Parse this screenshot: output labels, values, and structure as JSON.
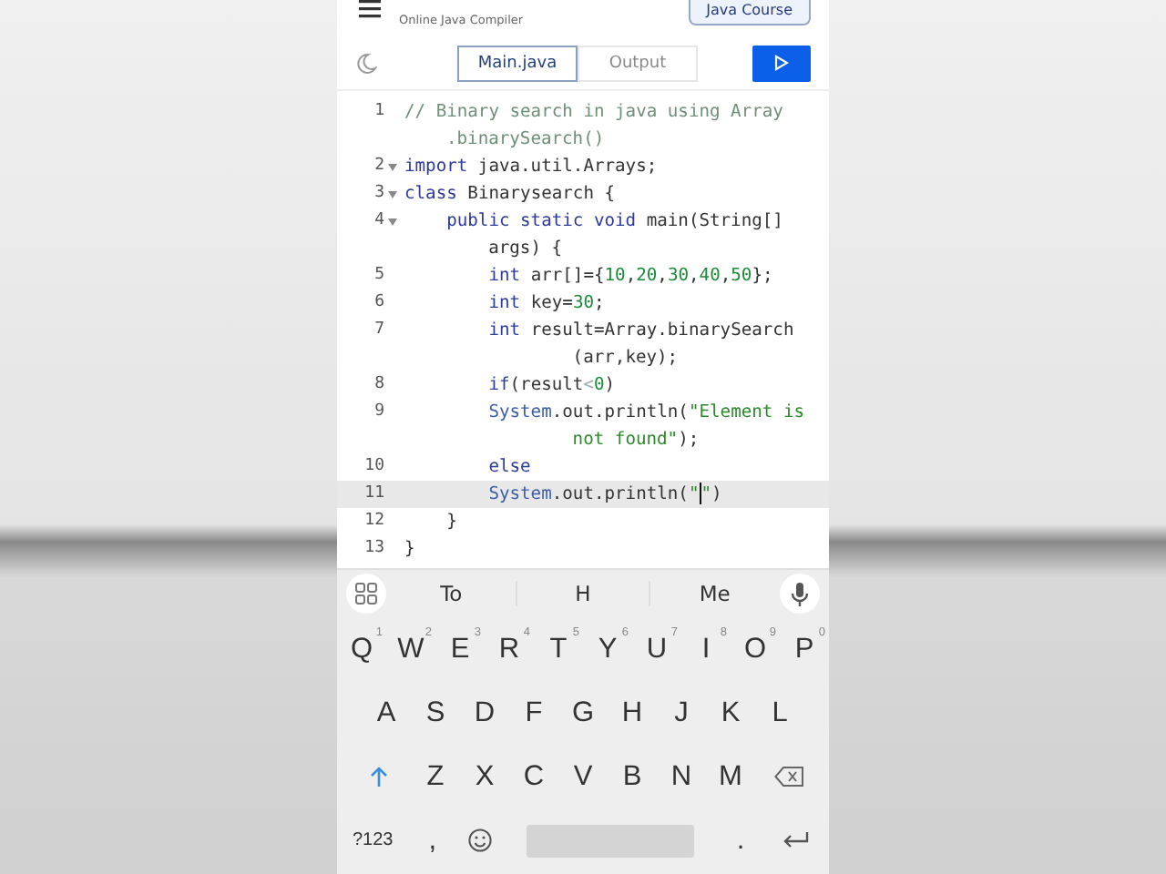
{
  "app_bar": {
    "subtitle": "Online Java Compiler",
    "course_button": "Java Course"
  },
  "toolbar": {
    "tabs": [
      {
        "label": "Main.java",
        "selected": true
      },
      {
        "label": "Output",
        "selected": false
      }
    ]
  },
  "editor": {
    "lines": [
      {
        "number": "1",
        "foldable": false,
        "current": false,
        "tokens": [
          {
            "kind": "comment",
            "text": "// Binary search in java using Array"
          },
          {
            "kind": "wrap"
          },
          {
            "kind": "comment",
            "text": ".binarySearch()"
          }
        ]
      },
      {
        "number": "2",
        "foldable": true,
        "current": false,
        "tokens": [
          {
            "kind": "keyword",
            "text": "import"
          },
          {
            "kind": "plain",
            "text": " java.util.Arrays;"
          }
        ]
      },
      {
        "number": "3",
        "foldable": true,
        "current": false,
        "tokens": [
          {
            "kind": "keyword",
            "text": "class"
          },
          {
            "kind": "plain",
            "text": " Binarysearch {"
          }
        ]
      },
      {
        "number": "4",
        "foldable": true,
        "current": false,
        "tokens": [
          {
            "kind": "keyword",
            "text": "    public static void"
          },
          {
            "kind": "plain",
            "text": " main(String[]"
          },
          {
            "kind": "wrap"
          },
          {
            "kind": "plain",
            "text": "    args) {"
          }
        ]
      },
      {
        "number": "5",
        "foldable": false,
        "current": false,
        "tokens": [
          {
            "kind": "keyword",
            "text": "        int"
          },
          {
            "kind": "plain",
            "text": " arr[]={"
          },
          {
            "kind": "number",
            "text": "10"
          },
          {
            "kind": "plain",
            "text": ","
          },
          {
            "kind": "number",
            "text": "20"
          },
          {
            "kind": "plain",
            "text": ","
          },
          {
            "kind": "number",
            "text": "30"
          },
          {
            "kind": "plain",
            "text": ","
          },
          {
            "kind": "number",
            "text": "40"
          },
          {
            "kind": "plain",
            "text": ","
          },
          {
            "kind": "number",
            "text": "50"
          },
          {
            "kind": "plain",
            "text": "};"
          }
        ]
      },
      {
        "number": "6",
        "foldable": false,
        "current": false,
        "tokens": [
          {
            "kind": "keyword",
            "text": "        int"
          },
          {
            "kind": "plain",
            "text": " key="
          },
          {
            "kind": "number",
            "text": "30"
          },
          {
            "kind": "plain",
            "text": ";"
          }
        ]
      },
      {
        "number": "7",
        "foldable": false,
        "current": false,
        "tokens": [
          {
            "kind": "keyword",
            "text": "        int"
          },
          {
            "kind": "plain",
            "text": " result=Array.binarySearch"
          },
          {
            "kind": "wrap"
          },
          {
            "kind": "plain",
            "text": "            (arr,key);"
          }
        ]
      },
      {
        "number": "8",
        "foldable": false,
        "current": false,
        "tokens": [
          {
            "kind": "keyword",
            "text": "        if"
          },
          {
            "kind": "plain",
            "text": "(result"
          },
          {
            "kind": "operator",
            "text": "<"
          },
          {
            "kind": "number",
            "text": "0"
          },
          {
            "kind": "plain",
            "text": ")"
          }
        ]
      },
      {
        "number": "9",
        "foldable": false,
        "current": false,
        "tokens": [
          {
            "kind": "type",
            "text": "        System"
          },
          {
            "kind": "plain",
            "text": ".out.println("
          },
          {
            "kind": "string",
            "text": "\"Element is"
          },
          {
            "kind": "wrap"
          },
          {
            "kind": "string",
            "text": "            not found\""
          },
          {
            "kind": "plain",
            "text": ");"
          }
        ]
      },
      {
        "number": "10",
        "foldable": false,
        "current": false,
        "tokens": [
          {
            "kind": "keyword",
            "text": "        else"
          }
        ]
      },
      {
        "number": "11",
        "foldable": false,
        "current": true,
        "tokens": [
          {
            "kind": "type",
            "text": "        System"
          },
          {
            "kind": "plain",
            "text": ".out.println("
          },
          {
            "kind": "string",
            "text": "\""
          },
          {
            "kind": "cursor"
          },
          {
            "kind": "string",
            "text": "\""
          },
          {
            "kind": "plain",
            "text": ")"
          }
        ]
      },
      {
        "number": "12",
        "foldable": false,
        "current": false,
        "tokens": [
          {
            "kind": "plain",
            "text": "    }"
          }
        ]
      },
      {
        "number": "13",
        "foldable": false,
        "current": false,
        "tokens": [
          {
            "kind": "plain",
            "text": "}"
          }
        ]
      }
    ]
  },
  "keyboard": {
    "suggestions": [
      "To",
      "H",
      "Me"
    ],
    "rows": [
      {
        "keys": [
          {
            "kind": "letter",
            "label": "Q",
            "hint": "1"
          },
          {
            "kind": "letter",
            "label": "W",
            "hint": "2"
          },
          {
            "kind": "letter",
            "label": "E",
            "hint": "3"
          },
          {
            "kind": "letter",
            "label": "R",
            "hint": "4"
          },
          {
            "kind": "letter",
            "label": "T",
            "hint": "5"
          },
          {
            "kind": "letter",
            "label": "Y",
            "hint": "6"
          },
          {
            "kind": "letter",
            "label": "U",
            "hint": "7"
          },
          {
            "kind": "letter",
            "label": "I",
            "hint": "8"
          },
          {
            "kind": "letter",
            "label": "O",
            "hint": "9"
          },
          {
            "kind": "letter",
            "label": "P",
            "hint": "0"
          }
        ]
      },
      {
        "keys": [
          {
            "kind": "letter",
            "label": "A"
          },
          {
            "kind": "letter",
            "label": "S"
          },
          {
            "kind": "letter",
            "label": "D"
          },
          {
            "kind": "letter",
            "label": "F"
          },
          {
            "kind": "letter",
            "label": "G"
          },
          {
            "kind": "letter",
            "label": "H"
          },
          {
            "kind": "letter",
            "label": "J"
          },
          {
            "kind": "letter",
            "label": "K"
          },
          {
            "kind": "letter",
            "label": "L"
          }
        ]
      },
      {
        "keys": [
          {
            "kind": "shift"
          },
          {
            "kind": "letter",
            "label": "Z"
          },
          {
            "kind": "letter",
            "label": "X"
          },
          {
            "kind": "letter",
            "label": "C"
          },
          {
            "kind": "letter",
            "label": "V"
          },
          {
            "kind": "letter",
            "label": "B"
          },
          {
            "kind": "letter",
            "label": "N"
          },
          {
            "kind": "letter",
            "label": "M"
          },
          {
            "kind": "backspace"
          }
        ]
      },
      {
        "keys": [
          {
            "kind": "symbols",
            "label": "?123"
          },
          {
            "kind": "letter",
            "label": ","
          },
          {
            "kind": "emoji"
          },
          {
            "kind": "space"
          },
          {
            "kind": "letter",
            "label": "."
          },
          {
            "kind": "enter"
          }
        ]
      }
    ]
  }
}
